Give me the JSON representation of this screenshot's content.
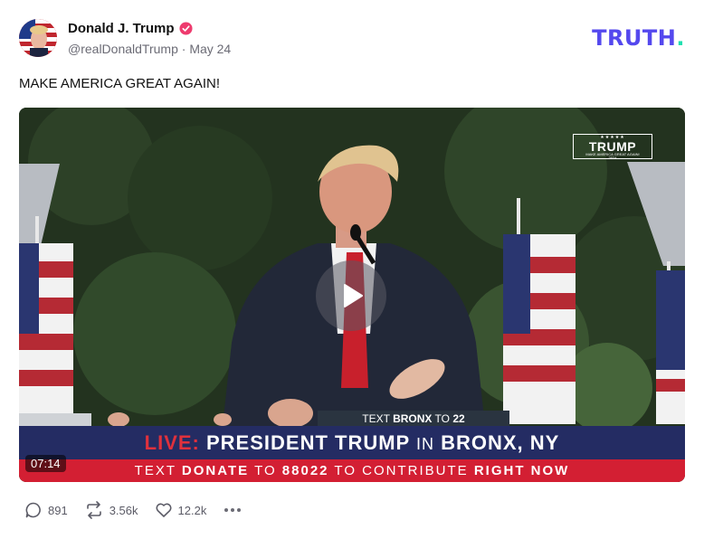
{
  "post": {
    "author_name": "Donald J. Trump",
    "handle": "@realDonaldTrump",
    "separator": "·",
    "date": "May 24",
    "text": "MAKE AMERICA GREAT AGAIN!"
  },
  "brand": {
    "logo_text": "TRUTH",
    "logo_dot": ".",
    "logo_color": "#5448ee",
    "dot_color": "#1ee0b0"
  },
  "video": {
    "duration": "07:14",
    "campaign_logo": {
      "stars": "★★★★★",
      "title": "TRUMP",
      "subtitle": "MAKE AMERICA GREAT AGAIN!",
      "year": "2024"
    },
    "podium_sign": {
      "prefix": "TEXT",
      "keyword": "BRONX",
      "rest": "TO",
      "number": "22"
    },
    "banner": {
      "live": "LIVE:",
      "part1": "PRESIDENT TRUMP",
      "part2": "IN",
      "part3": "BRONX, NY",
      "text_word": "TEXT",
      "donate": "DONATE",
      "to": "TO",
      "number": "88022",
      "contribute": "TO CONTRIBUTE",
      "right_now": "RIGHT NOW"
    }
  },
  "actions": {
    "replies": "891",
    "retruths": "3.56k",
    "likes": "12.2k"
  }
}
